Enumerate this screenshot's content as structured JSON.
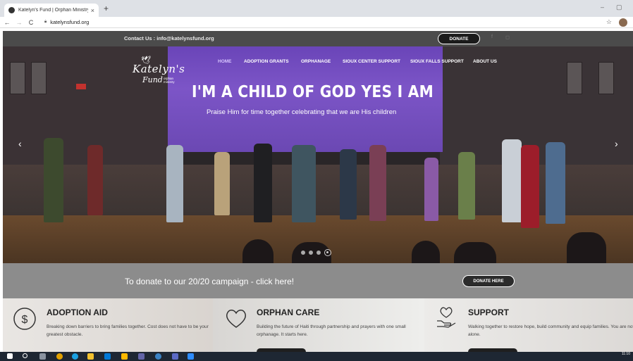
{
  "browser": {
    "tab_title": "Katelyn's Fund | Orphan Ministry",
    "tab_close": "×",
    "new_tab": "+",
    "url": "katelynsfund.org",
    "window_min": "–",
    "window_restore": "▢"
  },
  "topbar": {
    "contact": "Contact Us : info@katelynsfund.org",
    "donate_label": "DONATE"
  },
  "logo": {
    "script": "Katelyn's",
    "fund": "Fund",
    "tagline": "orphan ministry"
  },
  "nav": {
    "items": [
      {
        "label": "HOME",
        "active": true
      },
      {
        "label": "ADOPTION GRANTS"
      },
      {
        "label": "ORPHANAGE"
      },
      {
        "label": "SIOUX CENTER SUPPORT"
      },
      {
        "label": "SIOUX FALLS SUPPORT"
      },
      {
        "label": "ABOUT US"
      }
    ]
  },
  "hero": {
    "headline": "I'M A CHILD OF GOD YES I AM",
    "subline": "Praise Him for time together celebrating that we are His children",
    "prev": "‹",
    "next": "›",
    "slide_count": 4,
    "active_slide": 4
  },
  "campaign": {
    "text": "To donate to our 20/20 campaign - click here!",
    "button": "DONATE HERE"
  },
  "features": [
    {
      "title": "ADOPTION AID",
      "text": "Breaking down barriers to bring families together. Cost does not have to be your greatest obstacle.",
      "icon": "dollar-icon"
    },
    {
      "title": "ORPHAN CARE",
      "text": "Building the future of Haiti through partnership and prayers with one small orphanage. It starts here.",
      "icon": "heart-icon"
    },
    {
      "title": "SUPPORT",
      "text": "Walking together to restore hope, build community and equip families. You are not alone.",
      "icon": "heart-hand-icon"
    }
  ],
  "taskbar": {
    "time": "11:10"
  },
  "colors": {
    "topbar": "#4b4b4b",
    "campaign": "#8c8c8c",
    "hero_purple": "#7c55c7"
  }
}
